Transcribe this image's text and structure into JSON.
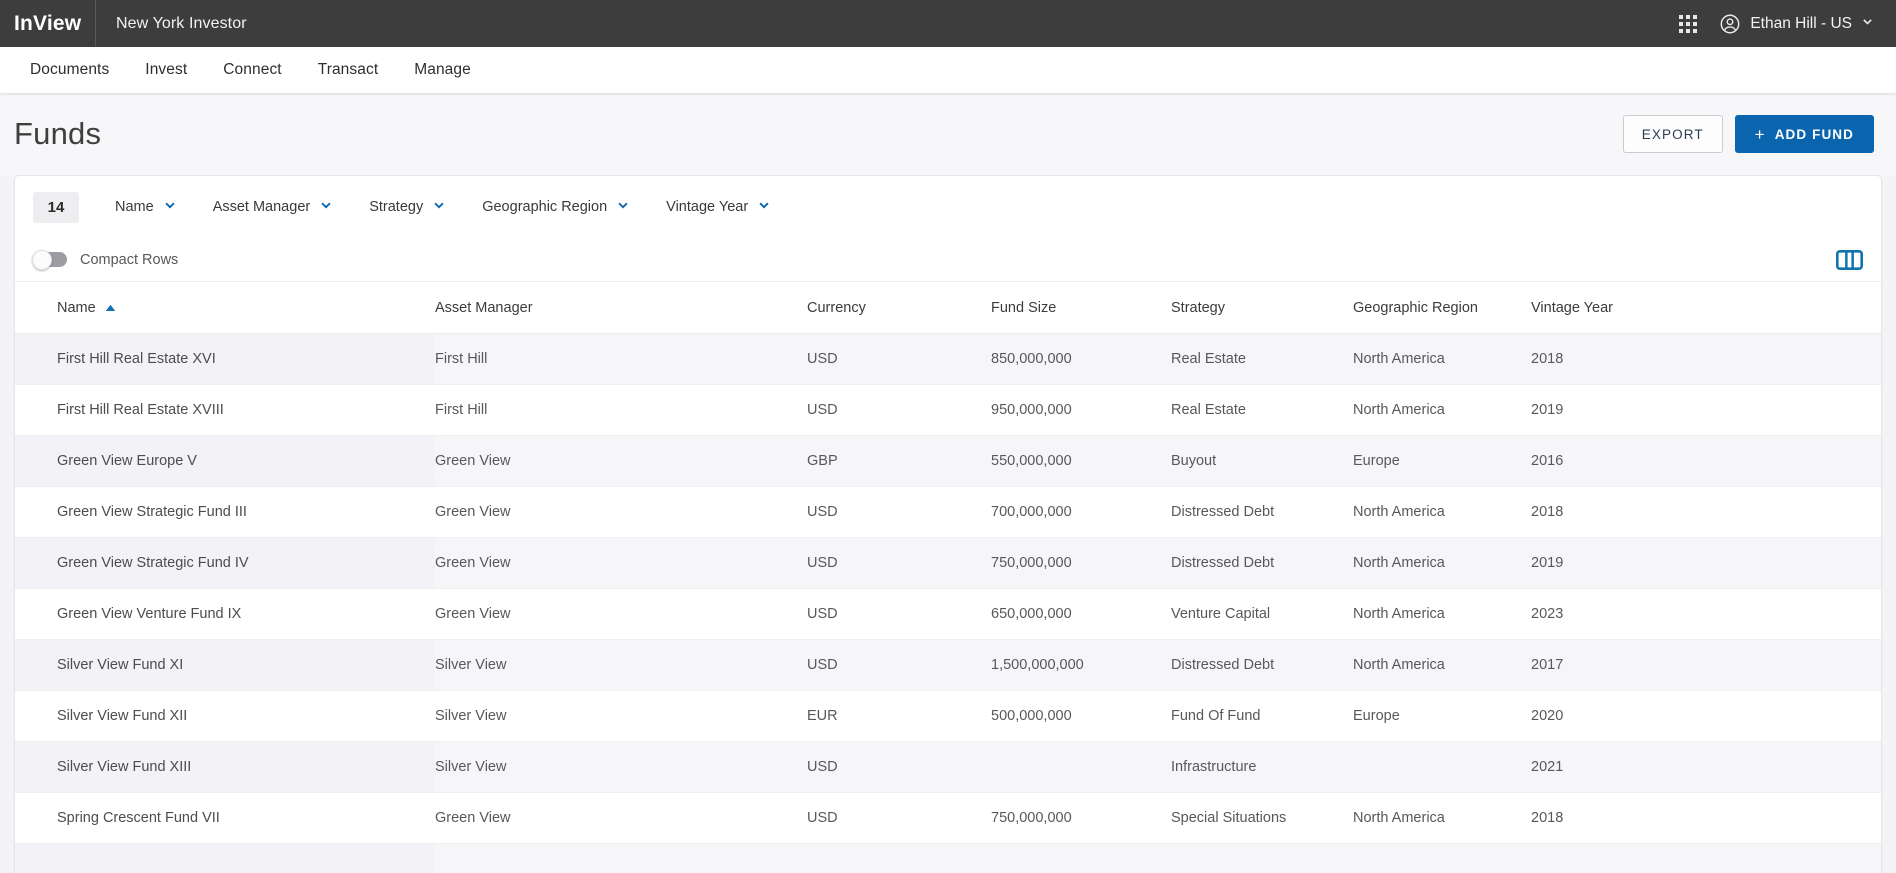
{
  "topbar": {
    "brand": "InView",
    "org": "New York Investor",
    "apps_icon": "grid-apps-icon",
    "user": "Ethan Hill - US",
    "avatar_icon": "account-circle-icon",
    "caret_icon": "chevron-down-icon"
  },
  "nav": {
    "items": [
      {
        "label": "Documents"
      },
      {
        "label": "Invest"
      },
      {
        "label": "Connect"
      },
      {
        "label": "Transact"
      },
      {
        "label": "Manage"
      }
    ]
  },
  "header": {
    "title": "Funds",
    "export_label": "EXPORT",
    "add_label": "ADD FUND",
    "add_icon": "plus-icon"
  },
  "filters": {
    "count": "14",
    "items": [
      {
        "label": "Name"
      },
      {
        "label": "Asset Manager"
      },
      {
        "label": "Strategy"
      },
      {
        "label": "Geographic Region"
      },
      {
        "label": "Vintage Year"
      }
    ],
    "chevron_icon": "chevron-down-icon"
  },
  "toolbar": {
    "compact_rows_label": "Compact Rows",
    "compact_rows_on": false,
    "columns_icon": "columns-settings-icon"
  },
  "table": {
    "sort_column": "Name",
    "sort_direction": "asc",
    "sort_icon": "sort-ascending-triangle-icon",
    "columns": [
      "Name",
      "Asset Manager",
      "Currency",
      "Fund Size",
      "Strategy",
      "Geographic Region",
      "Vintage Year"
    ],
    "rows": [
      {
        "name": "First Hill Real Estate XVI",
        "manager": "First Hill",
        "currency": "USD",
        "size": "850,000,000",
        "strategy": "Real Estate",
        "region": "North America",
        "vintage": "2018"
      },
      {
        "name": "First Hill Real Estate XVIII",
        "manager": "First Hill",
        "currency": "USD",
        "size": "950,000,000",
        "strategy": "Real Estate",
        "region": "North America",
        "vintage": "2019"
      },
      {
        "name": "Green View Europe V",
        "manager": "Green View",
        "currency": "GBP",
        "size": "550,000,000",
        "strategy": "Buyout",
        "region": "Europe",
        "vintage": "2016"
      },
      {
        "name": "Green View Strategic Fund III",
        "manager": "Green View",
        "currency": "USD",
        "size": "700,000,000",
        "strategy": "Distressed Debt",
        "region": "North America",
        "vintage": "2018"
      },
      {
        "name": "Green View Strategic Fund IV",
        "manager": "Green View",
        "currency": "USD",
        "size": "750,000,000",
        "strategy": "Distressed Debt",
        "region": "North America",
        "vintage": "2019"
      },
      {
        "name": "Green View Venture Fund IX",
        "manager": "Green View",
        "currency": "USD",
        "size": "650,000,000",
        "strategy": "Venture Capital",
        "region": "North America",
        "vintage": "2023"
      },
      {
        "name": "Silver View Fund XI",
        "manager": "Silver View",
        "currency": "USD",
        "size": "1,500,000,000",
        "strategy": "Distressed Debt",
        "region": "North America",
        "vintage": "2017"
      },
      {
        "name": "Silver View Fund XII",
        "manager": "Silver View",
        "currency": "EUR",
        "size": "500,000,000",
        "strategy": "Fund Of Fund",
        "region": "Europe",
        "vintage": "2020"
      },
      {
        "name": "Silver View Fund XIII",
        "manager": "Silver View",
        "currency": "USD",
        "size": "",
        "strategy": "Infrastructure",
        "region": "",
        "vintage": "2021"
      },
      {
        "name": "Spring Crescent Fund VII",
        "manager": "Green View",
        "currency": "USD",
        "size": "750,000,000",
        "strategy": "Special Situations",
        "region": "North America",
        "vintage": "2018"
      },
      {
        "name": "",
        "manager": "",
        "currency": "",
        "size": "",
        "strategy": "",
        "region": "",
        "vintage": ""
      }
    ]
  },
  "colors": {
    "topbar_bg": "#3d3d3d",
    "accent_blue": "#0a64ae",
    "page_bg": "#f4f4f6",
    "row_alt": "#f6f5f8"
  }
}
